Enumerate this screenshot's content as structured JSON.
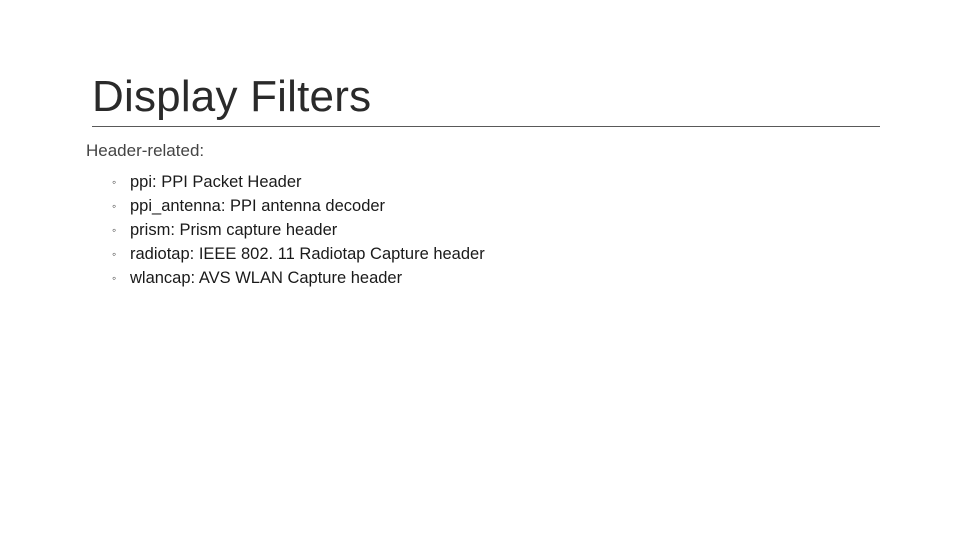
{
  "slide": {
    "title": "Display Filters",
    "subheading": "Header-related:",
    "items": [
      {
        "key": "ppi",
        "desc": "PPI Packet Header"
      },
      {
        "key": "ppi_antenna",
        "desc": "PPI antenna decoder"
      },
      {
        "key": "prism",
        "desc": "Prism capture header"
      },
      {
        "key": "radiotap",
        "desc": "IEEE 802. 11 Radiotap Capture header"
      },
      {
        "key": "wlancap",
        "desc": "AVS WLAN Capture header"
      }
    ],
    "bullet_glyph": "◦"
  }
}
